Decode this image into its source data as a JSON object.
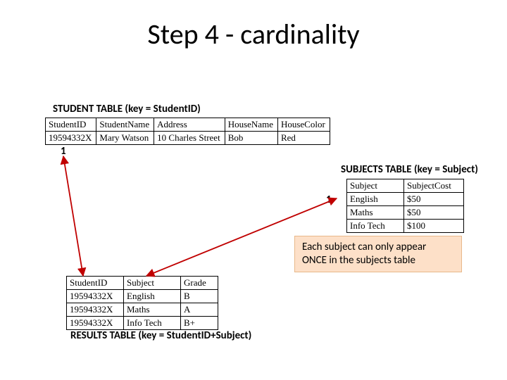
{
  "title": "Step 4 - cardinality",
  "student_caption": "STUDENT TABLE (key = StudentID)",
  "student_table": {
    "headers": [
      "StudentID",
      "StudentName",
      "Address",
      "HouseName",
      "HouseColor"
    ],
    "rows": [
      [
        "19594332X",
        "Mary Watson",
        "10 Charles Street",
        "Bob",
        "Red"
      ]
    ]
  },
  "subjects_caption": "SUBJECTS TABLE (key = Subject)",
  "subjects_table": {
    "headers": [
      "Subject",
      "SubjectCost"
    ],
    "rows": [
      [
        "English",
        "$50"
      ],
      [
        "Maths",
        "$50"
      ],
      [
        "Info Tech",
        "$100"
      ]
    ]
  },
  "results_caption": "RESULTS TABLE (key = StudentID+Subject)",
  "results_table": {
    "headers": [
      "StudentID",
      "Subject",
      "Grade"
    ],
    "rows": [
      [
        "19594332X",
        "English",
        "B"
      ],
      [
        "19594332X",
        "Maths",
        "A"
      ],
      [
        "19594332X",
        "Info Tech",
        "B+"
      ]
    ]
  },
  "cardinality": {
    "left": "1",
    "right": "1"
  },
  "note_line1": "Each subject can only appear",
  "note_line2": "ONCE in the subjects table",
  "colors": {
    "arrow": "#c00000"
  }
}
